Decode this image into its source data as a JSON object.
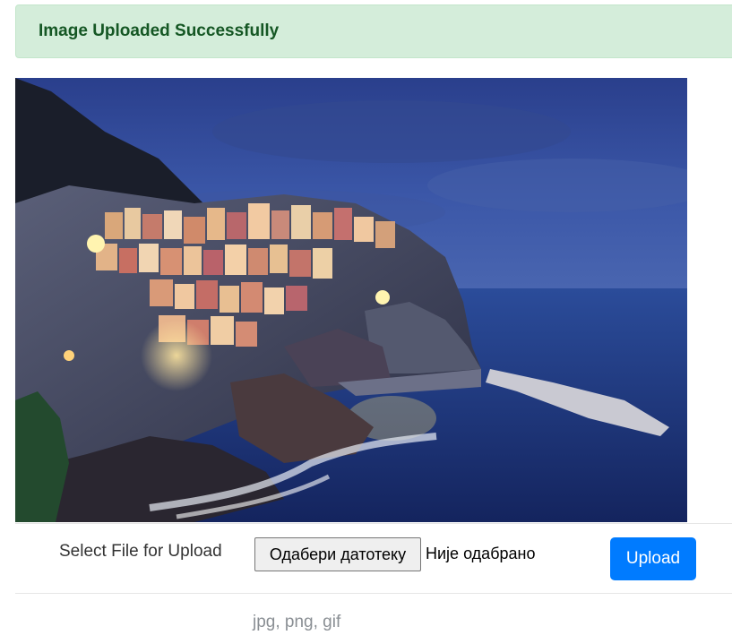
{
  "alert": {
    "message": "Image Uploaded Successfully",
    "color": "#155724",
    "background": "#d4edda"
  },
  "preview": {
    "image_name": "uploaded-photo",
    "description_icon": "coastal-village-at-dusk"
  },
  "upload_form": {
    "label": "Select File for Upload",
    "choose_button_label": "Одабери датотеку",
    "file_status": "Није одабрано",
    "upload_button_label": "Upload",
    "upload_button_color": "#007bff",
    "accepted_formats": "jpg, png, gif"
  }
}
